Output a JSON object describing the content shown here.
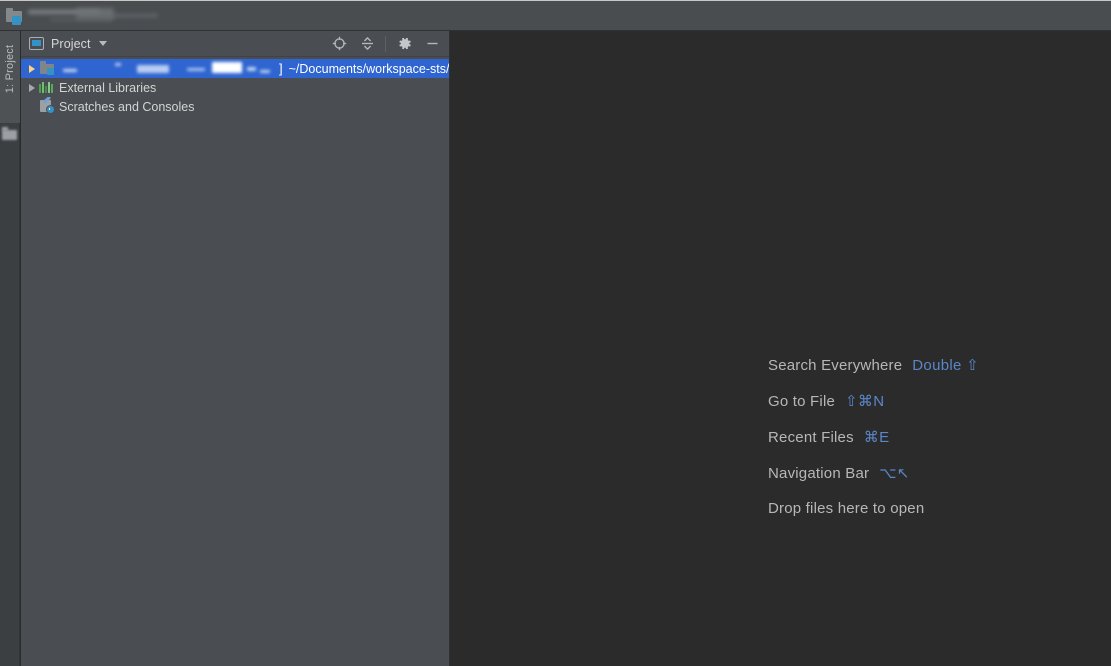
{
  "window": {
    "title_redacted": true,
    "folder_icon": "project-folder-icon"
  },
  "toolstrip": {
    "project_tab_label": "1: Project",
    "bottom_icon": "structure-icon"
  },
  "project_panel": {
    "header": {
      "title": "Project",
      "view_icon": "project-view-icon",
      "dropdown_icon": "chevron-down-icon",
      "actions": [
        {
          "name": "select-opened-file-icon",
          "tooltip": "Select Opened File"
        },
        {
          "name": "collapse-all-icon",
          "tooltip": "Collapse All"
        },
        {
          "name": "gear-icon",
          "tooltip": "Settings"
        },
        {
          "name": "minimize-icon",
          "tooltip": "Hide"
        }
      ]
    },
    "tree": [
      {
        "name": "project-root-node",
        "label_redacted": true,
        "bracket": "]",
        "path": "~/Documents/workspace-sts/",
        "icon": "module-folder-icon",
        "expandable": true,
        "selected": true
      },
      {
        "name": "external-libraries-node",
        "label": "External Libraries",
        "icon": "external-libraries-icon",
        "expandable": true,
        "selected": false
      },
      {
        "name": "scratches-and-consoles-node",
        "label": "Scratches and Consoles",
        "icon": "scratches-icon",
        "expandable": false,
        "selected": false
      }
    ]
  },
  "editor": {
    "empty_state": {
      "shortcuts": [
        {
          "name": "Search Everywhere",
          "keys": "Double ⇧"
        },
        {
          "name": "Go to File",
          "keys": "⇧⌘N"
        },
        {
          "name": "Recent Files",
          "keys": "⌘E"
        },
        {
          "name": "Navigation Bar",
          "keys": "⌥↖"
        }
      ],
      "drop_hint": "Drop files here to open"
    }
  },
  "colors": {
    "titlebar_bg": "#4a4d50",
    "panel_bg": "#4a4e52",
    "editor_bg": "#2b2b2b",
    "selection_blue": "#2f65d0",
    "accent_blue": "#5a87c9",
    "text_primary": "#d3d3d3",
    "text_muted": "#b7b7b7"
  }
}
